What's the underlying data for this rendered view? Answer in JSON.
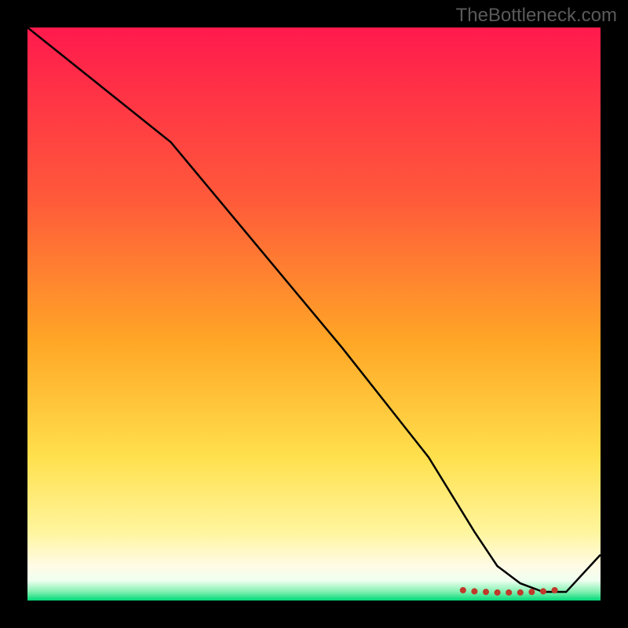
{
  "watermark": "TheBottleneck.com",
  "chart_data": {
    "type": "line",
    "title": "",
    "xlabel": "",
    "ylabel": "",
    "xlim": [
      0,
      100
    ],
    "ylim": [
      0,
      100
    ],
    "gradient_stops": [
      {
        "offset": 0,
        "color": "#ff1a4d"
      },
      {
        "offset": 0.3,
        "color": "#ff5a3a"
      },
      {
        "offset": 0.55,
        "color": "#ffa726"
      },
      {
        "offset": 0.75,
        "color": "#ffe04d"
      },
      {
        "offset": 0.88,
        "color": "#fff59d"
      },
      {
        "offset": 0.94,
        "color": "#fffbe6"
      },
      {
        "offset": 0.965,
        "color": "#f0fff0"
      },
      {
        "offset": 0.985,
        "color": "#80f0b0"
      },
      {
        "offset": 1.0,
        "color": "#00d978"
      }
    ],
    "series": [
      {
        "name": "curve",
        "color": "#000000",
        "width": 2.5,
        "x": [
          0,
          10,
          25,
          40,
          55,
          70,
          78,
          82,
          86,
          90,
          94,
          100
        ],
        "y": [
          100,
          92,
          80,
          62,
          44,
          25,
          12,
          6,
          3,
          1.5,
          1.5,
          8
        ]
      }
    ],
    "markers": {
      "color": "#c0392b",
      "radius": 3.2,
      "x": [
        76,
        78,
        80,
        82,
        84,
        86,
        88,
        90,
        92
      ],
      "y": [
        1.8,
        1.6,
        1.5,
        1.4,
        1.4,
        1.4,
        1.5,
        1.6,
        1.8
      ]
    }
  }
}
